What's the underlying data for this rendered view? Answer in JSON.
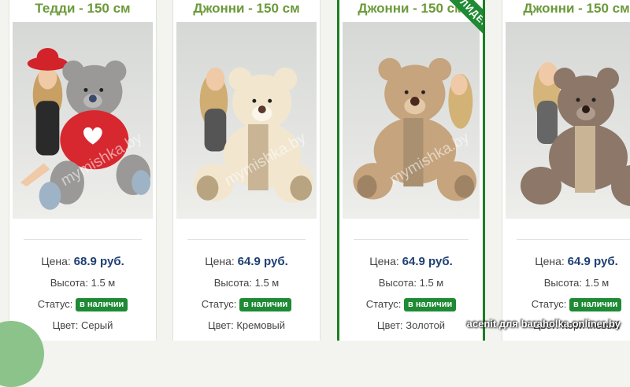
{
  "cards": [
    {
      "title": "Тедди - 150 см",
      "price_label": "Цена:",
      "price": "68.9 руб.",
      "height_label": "Высота:",
      "height": "1.5 м",
      "status_label": "Статус:",
      "status": "в наличии",
      "color_label": "Цвет:",
      "color": "Серый",
      "bear_color": "#9a9998",
      "shirt_color": "#d7282f",
      "watermark": "mymishka.by"
    },
    {
      "title": "Джонни - 150 см",
      "price_label": "Цена:",
      "price": "64.9 руб.",
      "height_label": "Высота:",
      "height": "1.5 м",
      "status_label": "Статус:",
      "status": "в наличии",
      "color_label": "Цвет:",
      "color": "Кремовый",
      "bear_color": "#f2e6cf",
      "watermark": "mymishka.by"
    },
    {
      "title": "Джонни - 150 см",
      "price_label": "Цена:",
      "price": "64.9 руб.",
      "height_label": "Высота:",
      "height": "1.5 м",
      "status_label": "Статус:",
      "status": "в наличии",
      "color_label": "Цвет:",
      "color": "Золотой",
      "bear_color": "#c6a47d",
      "ribbon": "ЛИДЕР",
      "watermark": "mymishka.by"
    },
    {
      "title": "Джонни - 150 см",
      "price_label": "Цена:",
      "price": "64.9 руб.",
      "height_label": "Высота:",
      "height": "1.5 м",
      "status_label": "Статус:",
      "status": "в наличии",
      "color_label": "Цвет:",
      "color": "Коричневый",
      "bear_color": "#8c7768"
    }
  ],
  "colors": {
    "title": "#6b9a3a",
    "price": "#1e3f73",
    "badge": "#1e8a34",
    "leader_border": "#1e7e23"
  },
  "caption": "acenit для baraholka.onliner.by"
}
